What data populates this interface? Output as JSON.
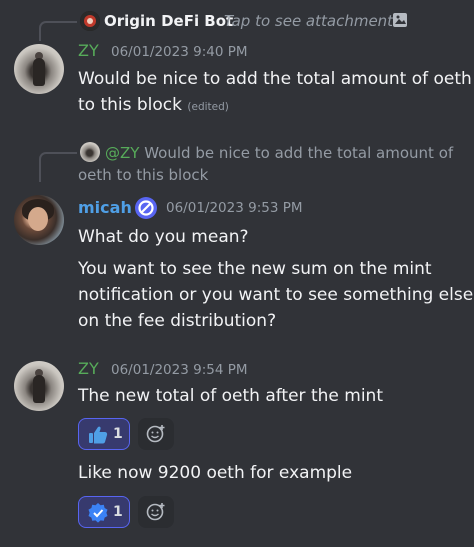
{
  "top_reply": {
    "author": "Origin DeFi Bot",
    "hint": "Tap to see attachment"
  },
  "msg1": {
    "author": "ZY",
    "timestamp": "06/01/2023 9:40 PM",
    "line1": "Would be nice to add the total amount of oeth",
    "line2": "to this block",
    "edited": "(edited)"
  },
  "reply2": {
    "mention": "@ZY",
    "line1": "Would be nice to add the total amount of",
    "line2": "oeth to this block"
  },
  "msg2": {
    "author": "micah",
    "timestamp": "06/01/2023 9:53 PM",
    "line1": "What do you mean?",
    "line2": "You want to see the new sum on the mint",
    "line3": "notification or you want to see something else",
    "line4": "on the fee distribution?"
  },
  "msg3": {
    "author": "ZY",
    "timestamp": "06/01/2023 9:54 PM",
    "line1": "The new total of oeth after the mint",
    "reaction1_count": "1",
    "line2": "Like now 9200 oeth for example",
    "reaction2_count": "1"
  },
  "colors": {
    "background": "#313338",
    "zy_name": "#57ab5a",
    "micah_name": "#4f9fe6",
    "reaction_bg": "#373a6e",
    "reaction_border": "#5865f2"
  }
}
